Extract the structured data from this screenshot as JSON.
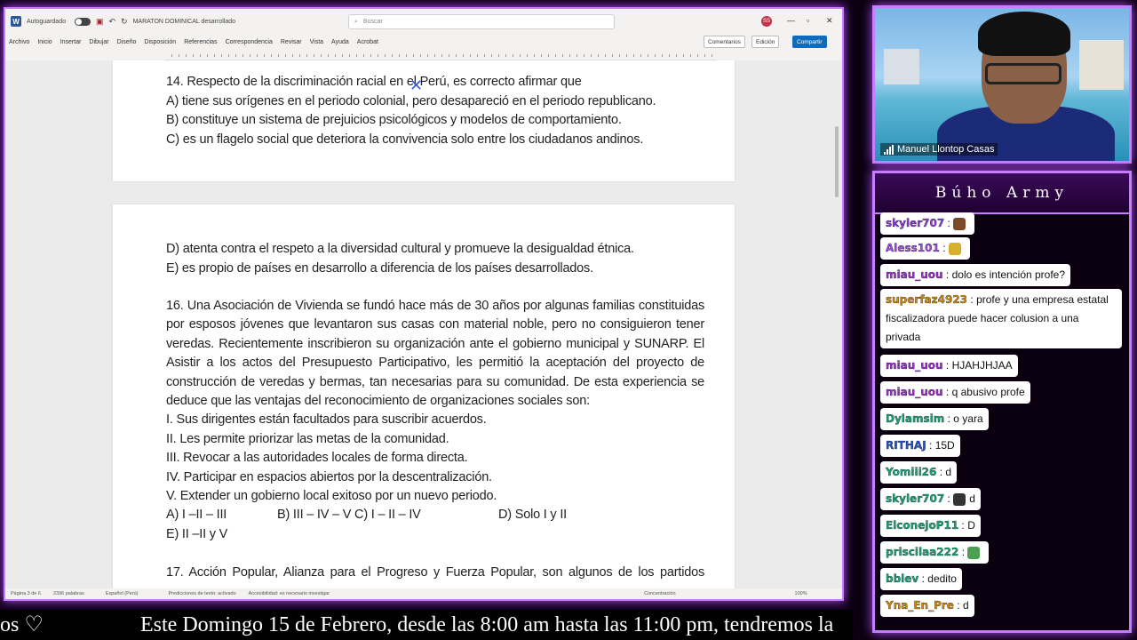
{
  "word": {
    "autosave_label": "Autoguardado",
    "doc_title": "MARATON DOMINICAL desarrollado",
    "search_placeholder": "Buscar",
    "user_initials": "SS",
    "menu": [
      "Archivo",
      "Inicio",
      "Insertar",
      "Dibujar",
      "Diseño",
      "Disposición",
      "Referencias",
      "Correspondencia",
      "Revisar",
      "Vista",
      "Ayuda",
      "Acrobat"
    ],
    "comments_label": "Comentarios",
    "edit_label": "Edición",
    "share_label": "Compartir",
    "status": {
      "page": "Página 3 de 6",
      "words": "2396 palabras",
      "language": "Español (Perú)",
      "predictions": "Predicciones de texto: activado",
      "accessibility": "Accesibilidad: es necesario investigar",
      "focus": "Concentración",
      "zoom": "100%"
    }
  },
  "document": {
    "page1": [
      "14.  Respecto de la discriminación racial en el Perú, es correcto afirmar que",
      "A) tiene sus orígenes en el periodo colonial, pero desapareció en el periodo republicano.",
      "B) constituye un sistema de prejuicios psicológicos y modelos de comportamiento.",
      "C) es un flagelo social que deteriora la convivencia solo entre los ciudadanos andinos."
    ],
    "page2": [
      "D) atenta contra el respeto a la diversidad cultural y promueve la desigualdad étnica.",
      "E) es propio de países en desarrollo a diferencia de los países desarrollados.",
      "16. Una Asociación de Vivienda se fundó hace más de 30 años por algunas familias constituidas",
      "por esposos jóvenes que levantaron sus casas con material noble, pero no consiguieron tener",
      "veredas. Recientemente inscribieron su organización ante el gobierno municipal y SUNARP. El",
      "Asistir a los actos del Presupuesto Participativo, les permitió la aceptación del proyecto de",
      "construcción de veredas y bermas, tan necesarias para su comunidad. De esta experiencia se",
      "deduce que las ventajas del reconocimiento de organizaciones sociales son:",
      "I. Sus dirigentes están facultados para suscribir acuerdos.",
      "II. Les permite priorizar las metas de la comunidad.",
      "III. Revocar a las autoridades locales de forma directa.",
      "IV. Participar en espacios abiertos por la descentralización.",
      "V. Extender un gobierno local exitoso por un nuevo periodo.",
      "A) I –II – III",
      "B) III – IV – V C) I – II – IV",
      "D) Solo I y II",
      "E) II –II y V",
      "17. Acción Popular, Alianza para el Progreso y Fuerza Popular, son algunos de los partidos"
    ]
  },
  "webcam": {
    "name": "Manuel Llontop Casas"
  },
  "chat": {
    "title": "Búho Army",
    "messages": [
      {
        "user": "skyler707",
        "text": "",
        "color": "#8a3fd6",
        "emote": "#7a4a2a"
      },
      {
        "user": "Aless101",
        "text": "",
        "color": "#9b4fe0",
        "emote": "#d8b030"
      },
      {
        "user": "miau_uou",
        "text": "dolo es intención profe?",
        "color": "#9b2fd0"
      },
      {
        "user": "superfaz4923",
        "text": "profe y una empresa estatal fiscalizadora puede hacer colusion a una privada",
        "color": "#d08a10"
      },
      {
        "user": "miau_uou",
        "text": "HJAHJHJAA",
        "color": "#9b2fd0"
      },
      {
        "user": "miau_uou",
        "text": "q abusivo profe",
        "color": "#9b2fd0"
      },
      {
        "user": "Dylamsim",
        "text": "o yara",
        "color": "#1aa57a"
      },
      {
        "user": "RITHAJ",
        "text": "15D",
        "color": "#2a52c8"
      },
      {
        "user": "Yomiii26",
        "text": "d",
        "color": "#1aa57a"
      },
      {
        "user": "skyler707",
        "text": "d",
        "color": "#1aa57a",
        "emote": "#333333"
      },
      {
        "user": "ElconejoP11",
        "text": "D",
        "color": "#1aa57a"
      },
      {
        "user": "priscilaa222",
        "text": "",
        "color": "#1aa57a",
        "emote": "#4aa050"
      },
      {
        "user": "bblev",
        "text": "dedito",
        "color": "#1aa57a"
      },
      {
        "user": "Yna_En_Pre",
        "text": "d",
        "color": "#d08a10"
      }
    ]
  },
  "ticker": {
    "left": "os ♡",
    "main": "Este Domingo 15 de Febrero, desde las 8:00 am hasta las 11:00 pm, tendremos la"
  }
}
